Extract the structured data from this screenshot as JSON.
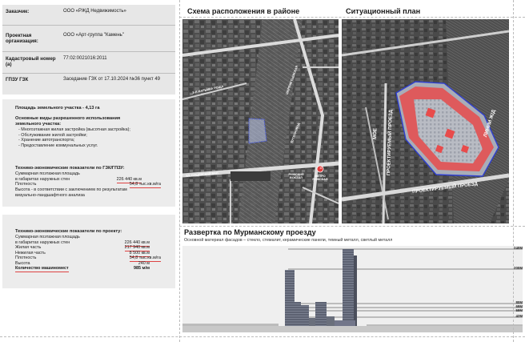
{
  "info": {
    "customer_label": "Заказчик:",
    "customer_value": "ООО «РЖД Недвижимость»",
    "designer_label": "Проектная организация:",
    "designer_value": "ООО «Арт-группа \"Камень\"",
    "cadastral_label": "Кадастровый номер (а)",
    "cadastral_value": "77:02:0021016:2011",
    "gpzu_label": "ГПЗУ ГЗК",
    "gpzu_value": "Заседание ГЗК от 17.10.2024 №36 пункт 49"
  },
  "land": {
    "area_title": "Площадь земельного участка -  4,13 га",
    "uses_title": "Основные виды разрешенного использования земельного участка:",
    "uses": [
      "Многоэтажная жилая застройка (высотная застройка);",
      "Обслуживание жилой застройки;",
      "Хранение автотранспорта;",
      "Предоставление коммунальных услуг."
    ]
  },
  "gzk": {
    "title": "Технико-экономические показатели по ГЗК/ГПЗУ:",
    "rows": [
      {
        "k": "Суммарная поэтажная площадь",
        "v": ""
      },
      {
        "k": "в габаритах наружных стен",
        "v": "226 440 кв.м"
      },
      {
        "k": "Плотность",
        "v": "54,8 тыс.кв.м/га"
      }
    ],
    "note1": "Высота - в соответствии с заключением по результатам",
    "note2": "визуально-ландшафтного анализа"
  },
  "project": {
    "title": "Технико-экономические показатели по проекту:",
    "rows": [
      {
        "k": "Суммарная поэтажная площадь",
        "v": ""
      },
      {
        "k": "в габаритах наружных стен",
        "v": "226 440 кв.м"
      },
      {
        "k": "Жилая часть",
        "v": "217 940 кв.м"
      },
      {
        "k": "Нежилая часть",
        "v": "8 500 кв.м"
      },
      {
        "k": "Плотность",
        "v": "54,8 тыс.кв.м/га"
      },
      {
        "k": "Высота",
        "v": "240 м"
      },
      {
        "k": "Количество машиномест",
        "v": "985 м/м"
      }
    ]
  },
  "maps": {
    "scheme_title": "Схема расположения в районе",
    "situation_title": "Ситуационный план",
    "scheme_labels": {
      "street1": "3-Я МАРЬИНА РОЩА",
      "street2": "ШЕРЕМЕТЬЕВСКАЯ",
      "street3": "УЛ. СУЩЕВСКИЙ ВАЛ",
      "street4": "ПУТЕПРОВОД",
      "rizhsky": "РИЖСКИЙ ВОКЗАЛ",
      "metro": "МЕТРО РИЖСКАЯ"
    },
    "situation_labels": {
      "proezd_v": "ПРОЕКТИРУЕМЫЙ ПРОЕЗД",
      "proezd_h": "ПРОЕКТИРУЕМЫЙ ПРОЕЗД",
      "mo": "МОЕ",
      "zhd": "ЛИНИИ Ж/Д"
    }
  },
  "elevation": {
    "title": "Развертка по Мурманскому проезду",
    "subtitle": "Основной материал фасадов – стекло, стемалит, керамические панели, темный металл, светлый металл",
    "levels": [
      "240М",
      "200М",
      "80М",
      "69М",
      "59М",
      "42М"
    ]
  }
}
